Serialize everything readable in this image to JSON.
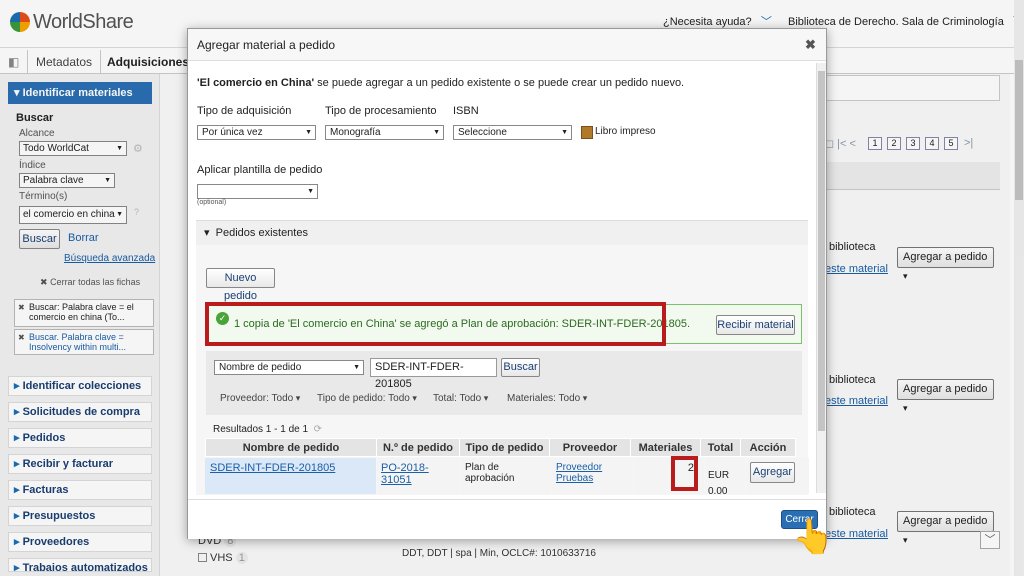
{
  "app": {
    "logo_text": "WorldShare"
  },
  "header": {
    "help": "¿Necesita ayuda?",
    "library": "Biblioteca de Derecho. Sala de Criminología"
  },
  "tabs": [
    "Metadatos",
    "Adquisiciones"
  ],
  "sidebar": {
    "section": "Identificar materiales",
    "search_heading": "Buscar",
    "scope_label": "Alcance",
    "scope_value": "Todo WorldCat",
    "index_label": "Índice",
    "index_value": "Palabra clave",
    "terms_label": "Término(s)",
    "terms_value": "el comercio en china",
    "search_button": "Buscar",
    "clear_button": "Borrar",
    "advanced": "Búsqueda avanzada",
    "close_all": "Cerrar todas las fichas",
    "recent": [
      "Buscar: Palabra clave = el comercio en china (To...",
      "Buscar. Palabra clave = Insolvency within multi..."
    ],
    "nav": [
      "Identificar colecciones",
      "Solicitudes de compra",
      "Pedidos",
      "Recibir y facturar",
      "Facturas",
      "Presupuestos",
      "Proveedores",
      "Trabajos automatizados"
    ]
  },
  "background": {
    "add_to_order": "Agregar a pedido",
    "biblio": "biblioteca",
    "see_material": "este material",
    "pages": [
      "1",
      "2",
      "3",
      "4",
      "5"
    ],
    "facets": [
      {
        "label": "DVD",
        "count": "8"
      },
      {
        "label": "VHS",
        "count": "1"
      }
    ],
    "record_line": "DDT, DDT | spa | Min, OCLC#: 1010633716"
  },
  "modal": {
    "title": "Agregar material a pedido",
    "intro_title": "'El comercio en China'",
    "intro_rest": "se puede agregar a un pedido existente o se puede crear un pedido nuevo.",
    "acq_label": "Tipo de adquisición",
    "acq_value": "Por única vez",
    "proc_label": "Tipo de procesamiento",
    "proc_value": "Monografía",
    "isbn_label": "ISBN",
    "isbn_value": "Seleccione",
    "format": "Libro impreso",
    "template_label": "Aplicar plantilla de pedido",
    "optional": "(optional)",
    "existing": "Pedidos existentes",
    "new_order": "Nuevo pedido",
    "success": "1 copia de 'El comercio en China' se agregó a Plan de aprobación: SDER-INT-FDER-201805.",
    "receive": "Recibir material",
    "filter_field": "Nombre de pedido",
    "filter_value": "SDER-INT-FDER-201805",
    "filter_button": "Buscar",
    "facets": [
      "Proveedor: Todo",
      "Tipo de pedido: Todo",
      "Total: Todo",
      "Materiales: Todo"
    ],
    "results": "Resultados 1 - 1 de 1",
    "columns": [
      "Nombre de pedido",
      "N.º de pedido",
      "Tipo de pedido",
      "Proveedor",
      "Materiales",
      "Total",
      "Acción"
    ],
    "rows": [
      {
        "name": "SDER-INT-FDER-201805",
        "number": "PO-2018-31051",
        "type": "Plan de aprobación",
        "vendor": "Proveedor Pruebas",
        "items": "2",
        "total": "EUR 0,00",
        "action": "Agregar"
      }
    ],
    "close": "Cerrar"
  }
}
